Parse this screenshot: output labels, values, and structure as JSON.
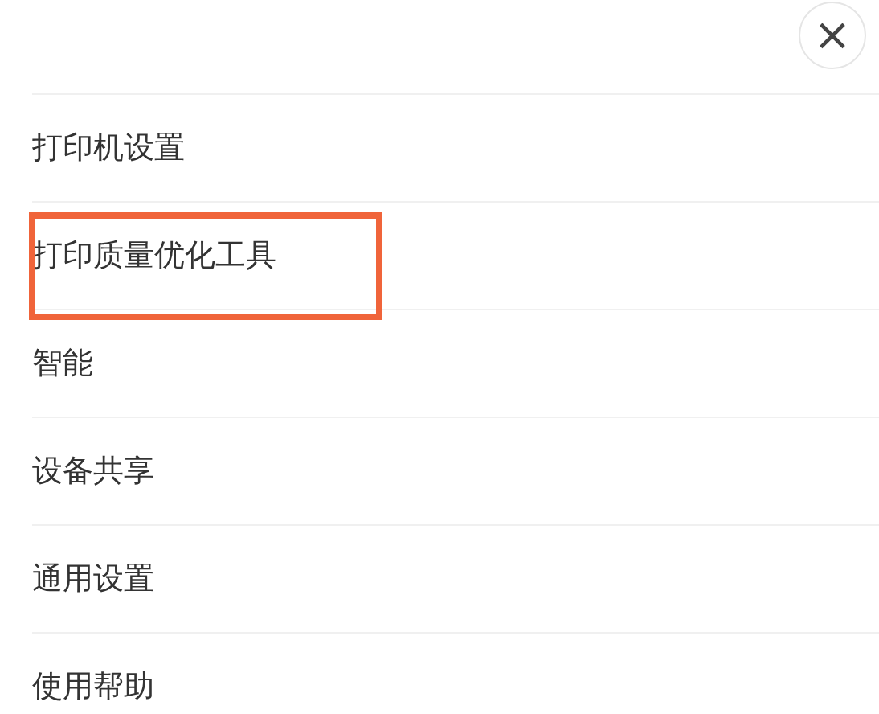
{
  "close_button": {
    "label": "×"
  },
  "menu": [
    {
      "label": "打印机设置",
      "highlighted": false
    },
    {
      "label": "打印质量优化工具",
      "highlighted": true
    },
    {
      "label": "智能",
      "highlighted": false
    },
    {
      "label": "设备共享",
      "highlighted": false
    },
    {
      "label": "通用设置",
      "highlighted": false
    },
    {
      "label": "使用帮助",
      "highlighted": false
    }
  ]
}
